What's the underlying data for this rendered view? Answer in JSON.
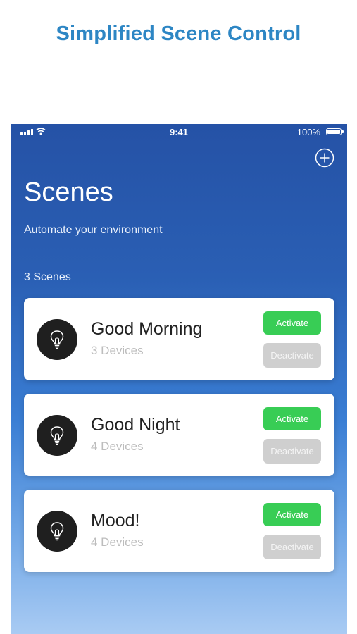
{
  "headline": "Simplified Scene Control",
  "status_bar": {
    "time": "9:41",
    "battery": "100%",
    "icons": [
      "signal-icon",
      "wifi-icon",
      "battery-icon"
    ]
  },
  "header": {
    "add_icon": "plus-circle-icon",
    "title": "Scenes",
    "subtitle": "Automate your environment"
  },
  "scene_count": "3 Scenes",
  "scenes": [
    {
      "name": "Good Morning",
      "devices": "3 Devices",
      "icon": "lightbulb-icon",
      "activate_label": "Activate",
      "deactivate_label": "Deactivate"
    },
    {
      "name": "Good Night",
      "devices": "4 Devices",
      "icon": "lightbulb-icon",
      "activate_label": "Activate",
      "deactivate_label": "Deactivate"
    },
    {
      "name": "Mood!",
      "devices": "4 Devices",
      "icon": "lightbulb-icon",
      "activate_label": "Activate",
      "deactivate_label": "Deactivate"
    }
  ],
  "colors": {
    "headline": "#2d86c4",
    "background_top": "#2552a6",
    "background_bottom": "#a9cbf3",
    "activate": "#38cd55",
    "deactivate": "#cfcfcf",
    "icon_circle": "#1f1f1f"
  }
}
